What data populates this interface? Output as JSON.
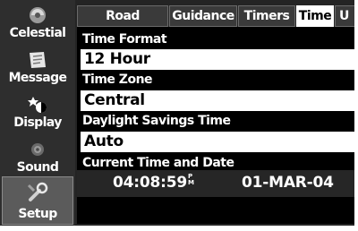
{
  "sidebar": {
    "items": [
      {
        "label": "Celestial",
        "icon": "celestial-icon"
      },
      {
        "label": "Message",
        "icon": "message-icon"
      },
      {
        "label": "Display",
        "icon": "display-icon"
      },
      {
        "label": "Sound",
        "icon": "sound-icon"
      },
      {
        "label": "Setup",
        "icon": "setup-icon",
        "selected": true
      }
    ]
  },
  "tabs": [
    {
      "label": "Road Routing"
    },
    {
      "label": "Guidance"
    },
    {
      "label": "Timers"
    },
    {
      "label": "Time",
      "active": true
    },
    {
      "label": "U"
    }
  ],
  "fields": {
    "time_format": {
      "label": "Time Format",
      "value": "12 Hour"
    },
    "time_zone": {
      "label": "Time Zone",
      "value": "Central"
    },
    "dst": {
      "label": "Daylight Savings Time",
      "value": "Auto"
    },
    "current": {
      "label": "Current Time and Date",
      "time": "04:08:59",
      "ampm_top": "P",
      "ampm_bottom": "M",
      "date": "01-MAR-04"
    }
  },
  "colors": {
    "background": "#242424",
    "content": "#000000",
    "highlight": "#ffffff"
  }
}
